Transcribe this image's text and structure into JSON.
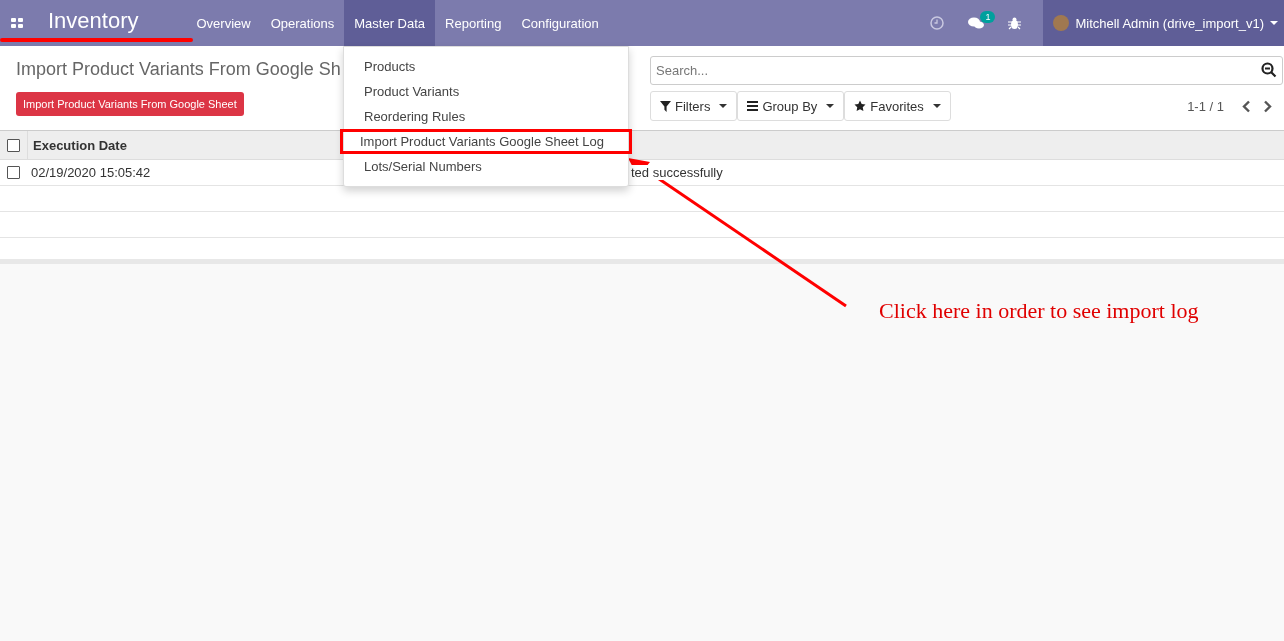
{
  "navbar": {
    "app_title": "Inventory",
    "menu": [
      {
        "label": "Overview",
        "selected": false
      },
      {
        "label": "Operations",
        "selected": false
      },
      {
        "label": "Master Data",
        "selected": true
      },
      {
        "label": "Reporting",
        "selected": false
      },
      {
        "label": "Configuration",
        "selected": false
      }
    ],
    "messages_badge": "1",
    "user": "Mitchell Admin (drive_import_v1)"
  },
  "dropdown": {
    "items": [
      {
        "label": "Products",
        "highlighted": false
      },
      {
        "label": "Product Variants",
        "highlighted": false
      },
      {
        "label": "Reordering Rules",
        "highlighted": false
      },
      {
        "label": "Import Product Variants Google Sheet Log",
        "highlighted": true
      },
      {
        "label": "Lots/Serial Numbers",
        "highlighted": false
      }
    ]
  },
  "control_panel": {
    "title": "Import Product Variants From Google Sh",
    "action_button": "Import Product Variants From Google Sheet",
    "search": {
      "placeholder": "Search..."
    },
    "filters": [
      {
        "kind": "filter",
        "label": "Filters"
      },
      {
        "kind": "group",
        "label": "Group By"
      },
      {
        "kind": "favorite",
        "label": "Favorites"
      }
    ],
    "pager": "1-1 / 1"
  },
  "table": {
    "columns": [
      "Execution Date"
    ],
    "rows": [
      {
        "checked": false,
        "cells": [
          "02/19/2020 15:05:42",
          "ted successfully"
        ]
      }
    ],
    "header_checked": false
  },
  "annotation": {
    "text": "Click here in order to see import log"
  }
}
